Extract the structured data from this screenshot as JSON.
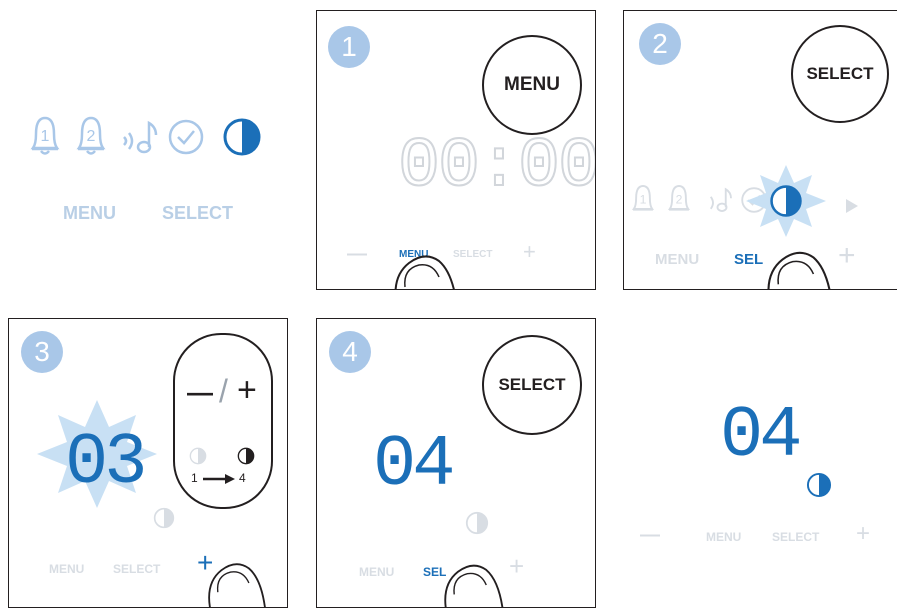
{
  "colors": {
    "accent": "#1b6fb8",
    "light_accent": "#a9c7e8",
    "faint": "#d8dde3",
    "outline": "#231f20"
  },
  "legend": {
    "icons": [
      "alarm-1-icon",
      "alarm-2-icon",
      "sound-icon",
      "check-icon",
      "brightness-icon"
    ],
    "menu_label": "MENU",
    "select_label": "SELECT"
  },
  "step1": {
    "badge": "1",
    "button_label": "MENU",
    "display": "00:00",
    "bottom": {
      "minus": "—",
      "menu": "MENU",
      "select": "SELECT",
      "plus": "+"
    }
  },
  "step2": {
    "badge": "2",
    "button_label": "SELECT",
    "bottom": {
      "menu": "MENU",
      "select": "SEL",
      "plus": "+"
    }
  },
  "step3": {
    "badge": "3",
    "display": "03",
    "control": {
      "minus": "—",
      "slash": "/",
      "plus": "+",
      "from": "1",
      "to": "4"
    },
    "bottom": {
      "menu": "MENU",
      "select": "SELECT",
      "plus": "+"
    }
  },
  "step4": {
    "badge": "4",
    "button_label": "SELECT",
    "display": "04",
    "bottom": {
      "menu": "MENU",
      "select": "SEL",
      "plus": "+"
    }
  },
  "result": {
    "display": "04",
    "bottom": {
      "minus": "—",
      "menu": "MENU",
      "select": "SELECT",
      "plus": "+"
    }
  }
}
